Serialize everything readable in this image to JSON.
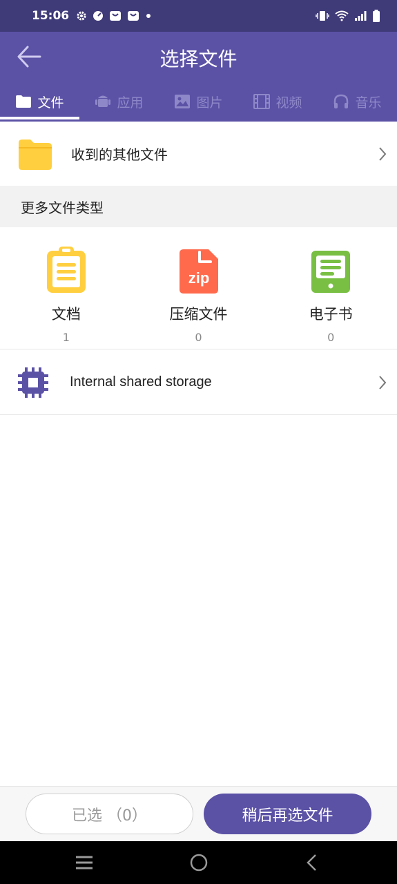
{
  "status": {
    "time": "15:06"
  },
  "appbar": {
    "title": "选择文件"
  },
  "tabs": [
    {
      "label": "文件",
      "icon": "folder-icon"
    },
    {
      "label": "应用",
      "icon": "android-icon"
    },
    {
      "label": "图片",
      "icon": "image-icon"
    },
    {
      "label": "视频",
      "icon": "film-icon"
    },
    {
      "label": "音乐",
      "icon": "headphones-icon"
    }
  ],
  "received": {
    "label": "收到的其他文件"
  },
  "more": {
    "header": "更多文件类型",
    "types": [
      {
        "name": "文档",
        "count": "1",
        "color": "#ffcf40"
      },
      {
        "name": "压缩文件",
        "count": "0",
        "color": "#ff6a4d",
        "badge": "zip"
      },
      {
        "name": "电子书",
        "count": "0",
        "color": "#79bf43"
      }
    ]
  },
  "storage": {
    "label": "Internal shared storage",
    "color": "#5b52a6"
  },
  "footer": {
    "selected": "已选 （0）",
    "later": "稍后再选文件"
  },
  "colors": {
    "primary": "#5b52a6",
    "statusbar": "#3f3a78"
  }
}
